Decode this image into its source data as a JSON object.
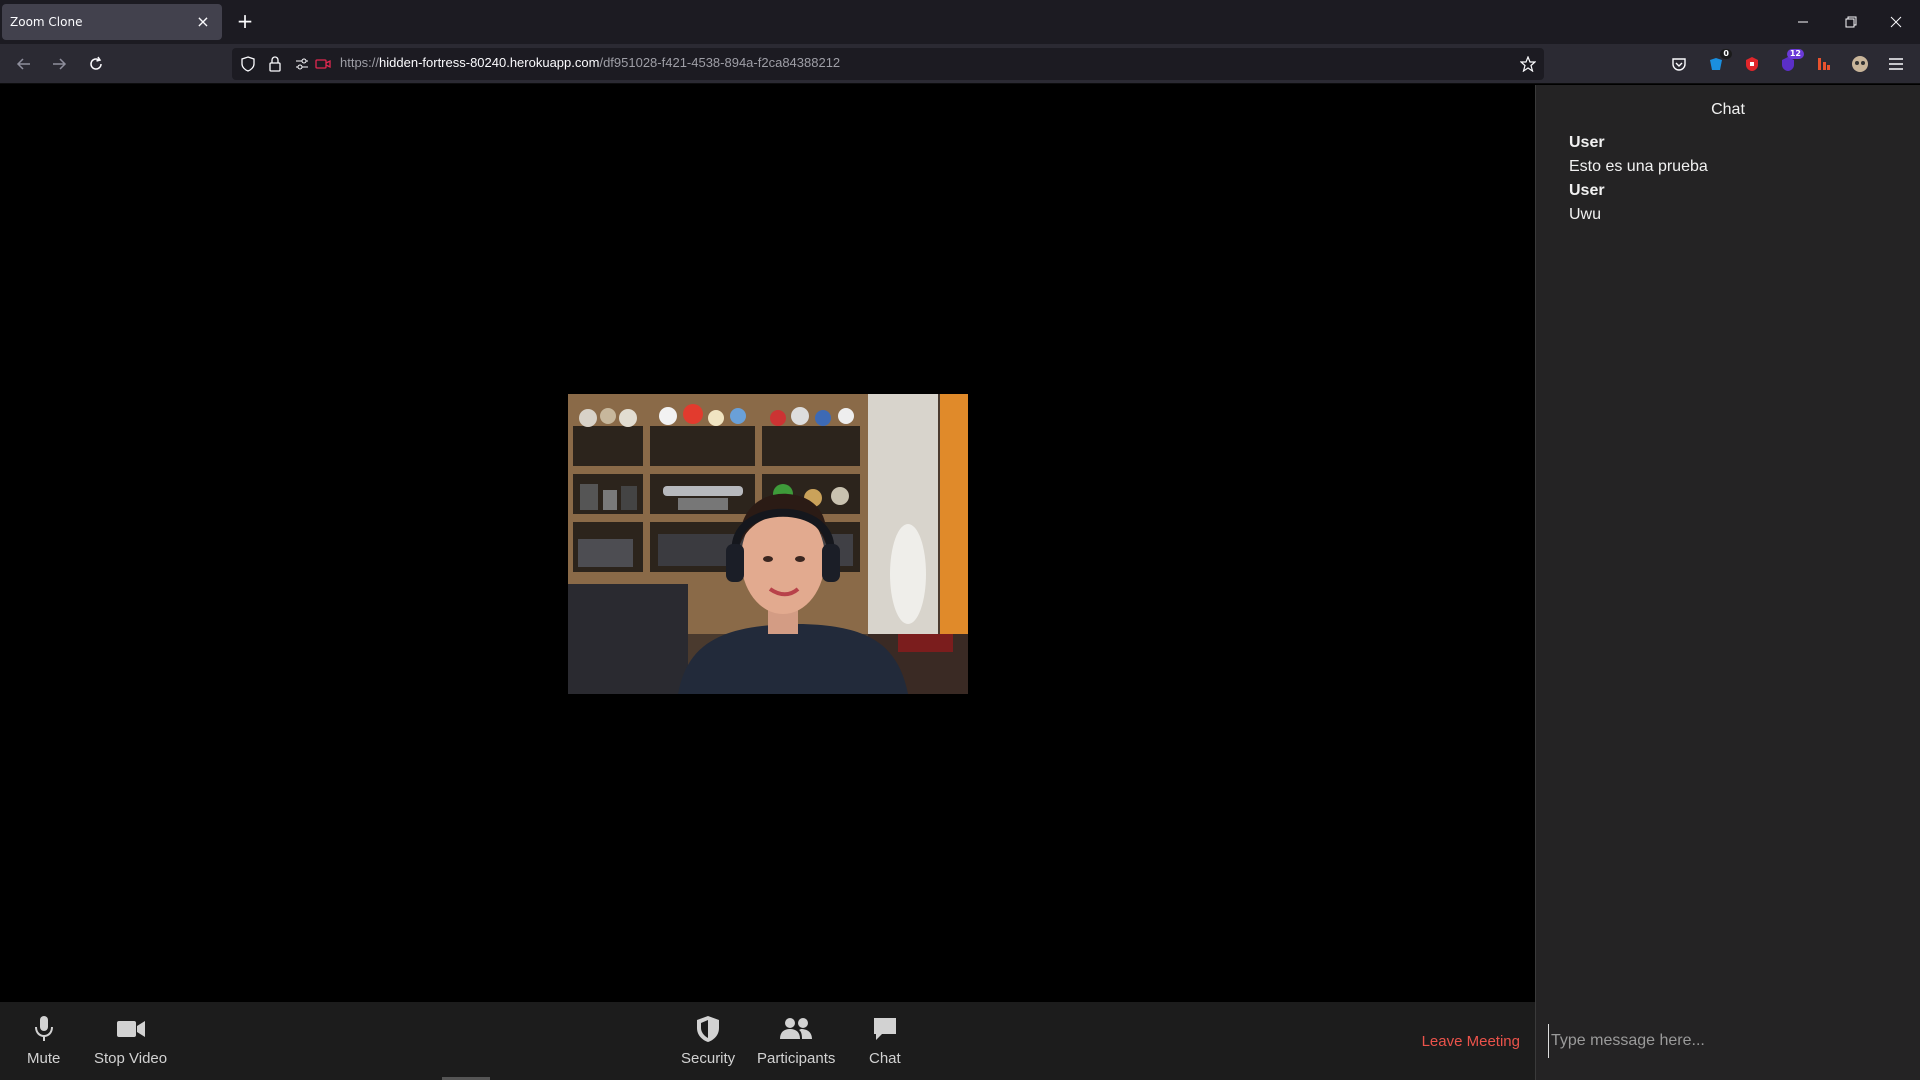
{
  "browser": {
    "tab_title": "Zoom Clone",
    "url_scheme": "https://",
    "url_host": "hidden-fortress-80240.herokuapp.com",
    "url_path": "/df951028-f421-4538-894a-f2ca84388212",
    "extension_badges": {
      "ext2": "0",
      "ext4": "12"
    }
  },
  "controls": {
    "mute_label": "Mute",
    "stop_video_label": "Stop Video",
    "security_label": "Security",
    "participants_label": "Participants",
    "chat_label": "Chat",
    "leave_label": "Leave Meeting"
  },
  "chat": {
    "title": "Chat",
    "messages": [
      {
        "user": "User",
        "text": "Esto es una prueba"
      },
      {
        "user": "User",
        "text": "Uwu"
      }
    ],
    "input_placeholder": "Type message here..."
  },
  "colors": {
    "leave": "#eb534b",
    "chrome_bg": "#1c1b22",
    "panel_bg": "#242324",
    "toolbar_bg": "#1c1c1c"
  }
}
